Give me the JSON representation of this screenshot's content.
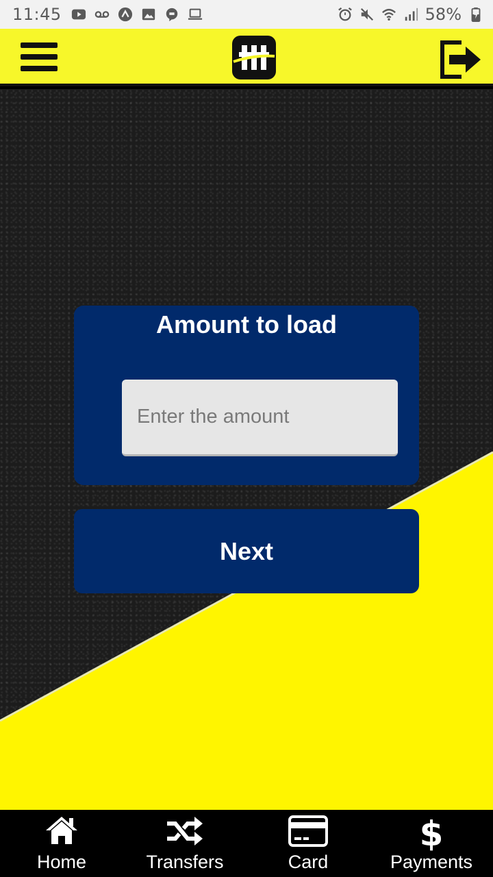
{
  "status_bar": {
    "time": "11:45",
    "battery": "58%"
  },
  "app_bar": {
    "menu_icon": "hamburger-icon",
    "logo_icon": "app-logo",
    "logout_icon": "logout-icon"
  },
  "form": {
    "title": "Amount to load",
    "amount_placeholder": "Enter the amount",
    "amount_value": "",
    "next_label": "Next"
  },
  "bottom_nav": {
    "items": [
      {
        "label": "Home",
        "icon": "home-icon"
      },
      {
        "label": "Transfers",
        "icon": "shuffle-icon"
      },
      {
        "label": "Card",
        "icon": "card-icon"
      },
      {
        "label": "Payments",
        "icon": "dollar-icon"
      }
    ]
  },
  "colors": {
    "accent_yellow": "#f7f72a",
    "navy": "#012a6b",
    "background_dark": "#1c1c1c"
  }
}
